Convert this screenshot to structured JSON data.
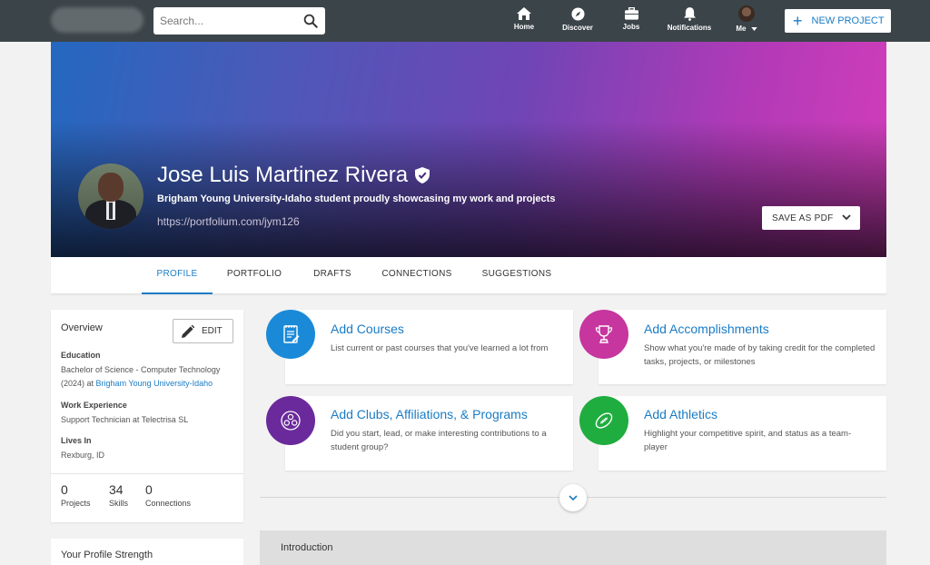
{
  "search": {
    "placeholder": "Search..."
  },
  "nav": {
    "home": "Home",
    "discover": "Discover",
    "jobs": "Jobs",
    "notifications": "Notifications",
    "me": "Me",
    "new_project": "NEW PROJECT"
  },
  "profile": {
    "name": "Jose Luis Martinez Rivera",
    "headline": "Brigham Young University-Idaho student proudly showcasing my work and projects",
    "url": "https://portfolium.com/jym126",
    "save_pdf": "SAVE AS PDF"
  },
  "tabs": [
    {
      "label": "PROFILE",
      "active": true
    },
    {
      "label": "PORTFOLIO"
    },
    {
      "label": "DRAFTS"
    },
    {
      "label": "CONNECTIONS"
    },
    {
      "label": "SUGGESTIONS"
    }
  ],
  "overview": {
    "title": "Overview",
    "edit": "EDIT",
    "education_label": "Education",
    "education_text": "Bachelor of Science - Computer Technology (2024) at",
    "education_link": "Brigham Young University-Idaho",
    "work_label": "Work Experience",
    "work_text": "Support Technician at Telectrisa SL",
    "lives_label": "Lives In",
    "lives_text": "Rexburg, ID",
    "stats": [
      {
        "value": "0",
        "label": "Projects"
      },
      {
        "value": "34",
        "label": "Skills"
      },
      {
        "value": "0",
        "label": "Connections"
      }
    ]
  },
  "strength": {
    "title": "Your Profile Strength"
  },
  "actions": [
    {
      "title": "Add Courses",
      "desc": "List current or past courses that you've learned a lot from",
      "color": "#1a8ad8",
      "icon": "notebook-icon"
    },
    {
      "title": "Add Accomplishments",
      "desc": "Show what you're made of by taking credit for the completed tasks, projects, or milestones",
      "color": "#c7359e",
      "icon": "trophy-icon"
    },
    {
      "title": "Add Clubs, Affiliations, & Programs",
      "desc": "Did you start, lead, or make interesting contributions to a student group?",
      "color": "#6b2a9c",
      "icon": "group-icon"
    },
    {
      "title": "Add Athletics",
      "desc": "Highlight your competitive spirit, and status as a team-player",
      "color": "#1fad3f",
      "icon": "football-icon"
    }
  ],
  "intro": {
    "title": "Introduction"
  }
}
